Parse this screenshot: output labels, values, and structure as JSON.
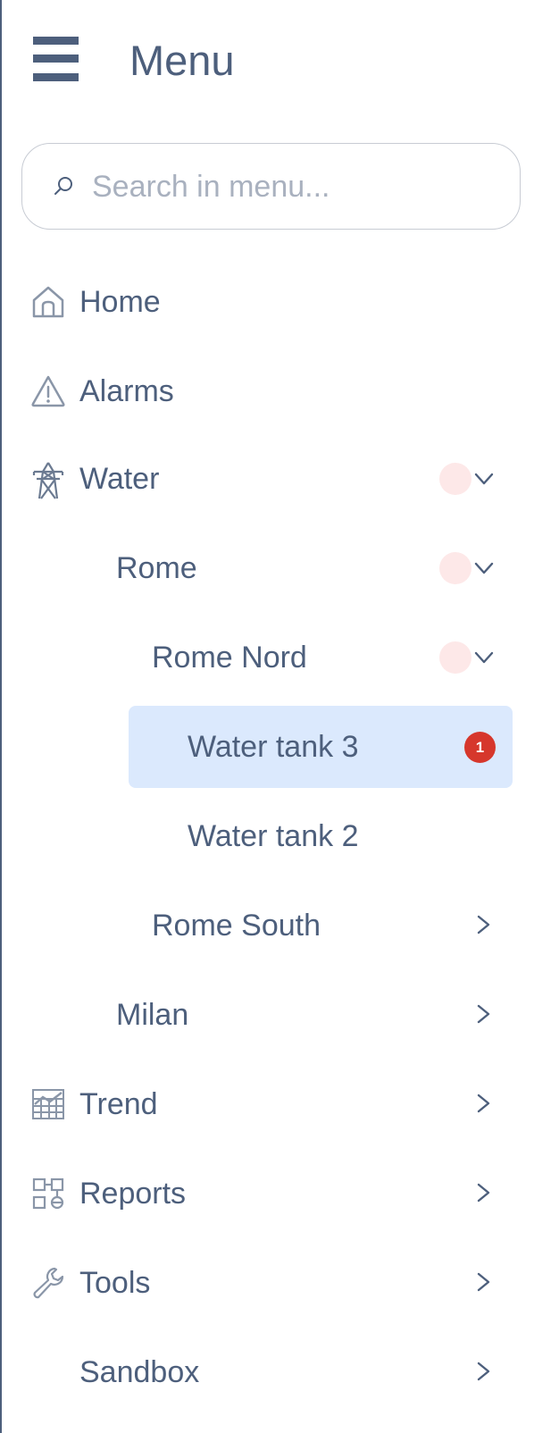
{
  "header": {
    "title": "Menu",
    "menu_icon": "hamburger-icon"
  },
  "search": {
    "placeholder": "Search in menu...",
    "value": "",
    "icon": "search-icon"
  },
  "menu": {
    "home": {
      "label": "Home",
      "icon": "home-icon"
    },
    "alarms": {
      "label": "Alarms",
      "icon": "warning-icon"
    },
    "water": {
      "label": "Water",
      "icon": "power-tower-icon",
      "expanded": true
    },
    "rome": {
      "label": "Rome",
      "expanded": true
    },
    "rome_nord": {
      "label": "Rome Nord",
      "expanded": true
    },
    "water_tank_3": {
      "label": "Water tank 3",
      "selected": true,
      "badge": "1"
    },
    "water_tank_2": {
      "label": "Water tank 2"
    },
    "rome_south": {
      "label": "Rome South",
      "expanded": false
    },
    "milan": {
      "label": "Milan",
      "expanded": false
    },
    "trend": {
      "label": "Trend",
      "icon": "chart-grid-icon",
      "expanded": false
    },
    "reports": {
      "label": "Reports",
      "icon": "reports-icon",
      "expanded": false
    },
    "tools": {
      "label": "Tools",
      "icon": "wrench-icon",
      "expanded": false
    },
    "sandbox": {
      "label": "Sandbox",
      "expanded": false
    }
  },
  "colors": {
    "text": "#4d5f7c",
    "selected_background": "#dbe9fd",
    "badge": "#d6372c",
    "faint_indicator": "#fde8e8"
  }
}
